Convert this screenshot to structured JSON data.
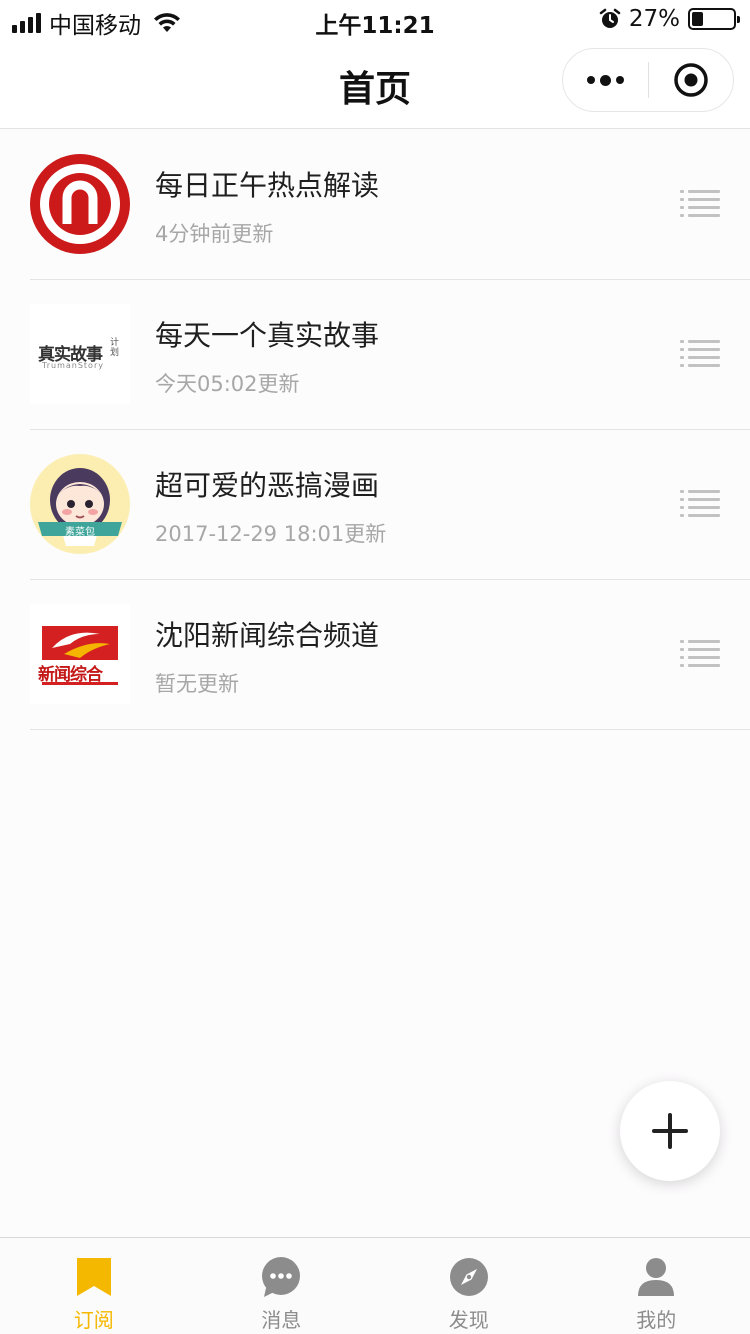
{
  "status_bar": {
    "carrier": "中国移动",
    "time": "上午11:21",
    "battery_percent": "27%",
    "battery_level": 0.27
  },
  "nav": {
    "title": "首页"
  },
  "subscriptions": [
    {
      "title": "每日正午热点解读",
      "updated": "4分钟前更新",
      "avatar": "red-n-logo"
    },
    {
      "title": "每天一个真实故事",
      "updated": "今天05:02更新",
      "avatar": "true-story-logo"
    },
    {
      "title": "超可爱的恶搞漫画",
      "updated": "2017-12-29 18:01更新",
      "avatar": "cartoon-girl-avatar",
      "avatar_badge": "素菜包"
    },
    {
      "title": "沈阳新闻综合频道",
      "updated": "暂无更新",
      "avatar": "shenyang-news-logo"
    }
  ],
  "logos": {
    "true_story_main": "真实故事",
    "true_story_side": "计划",
    "true_story_en": "TrumanStory",
    "shenyang_cn": "新闻综合"
  },
  "tab_bar": {
    "tabs": [
      {
        "label": "订阅",
        "icon": "bookmark-icon",
        "active": true
      },
      {
        "label": "消息",
        "icon": "chat-bubble-icon",
        "active": false
      },
      {
        "label": "发现",
        "icon": "compass-icon",
        "active": false
      },
      {
        "label": "我的",
        "icon": "person-icon",
        "active": false
      }
    ]
  },
  "colors": {
    "accent": "#f5b800",
    "tab_inactive": "#8c8c8c",
    "subtitle": "#a7a7a7",
    "red_logo": "#cc1a1a"
  }
}
